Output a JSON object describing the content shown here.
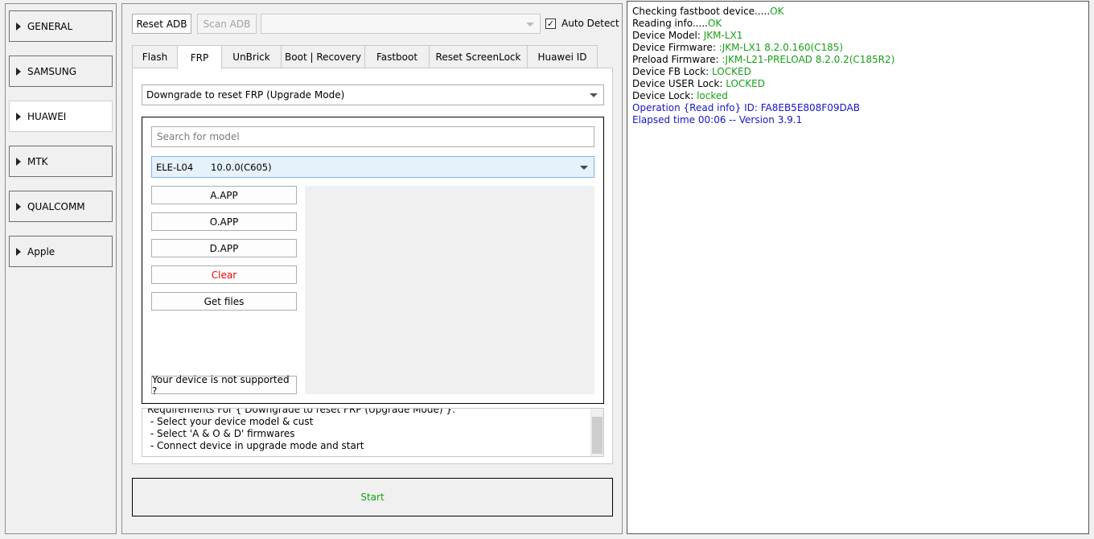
{
  "sidebar": {
    "items": [
      {
        "label": "GENERAL"
      },
      {
        "label": "SAMSUNG"
      },
      {
        "label": "HUAWEI",
        "active": true
      },
      {
        "label": "MTK"
      },
      {
        "label": "QUALCOMM"
      },
      {
        "label": "Apple"
      }
    ]
  },
  "toolbar": {
    "reset_adb": "Reset ADB",
    "scan_adb": "Scan ADB",
    "port_combo_value": "",
    "auto_detect_label": "Auto Detect",
    "auto_detect_checked": true
  },
  "tabs": [
    {
      "label": "Flash"
    },
    {
      "label": "FRP",
      "active": true
    },
    {
      "label": "UnBrick"
    },
    {
      "label": "Boot | Recovery"
    },
    {
      "label": "Fastboot"
    },
    {
      "label": "Reset ScreenLock"
    },
    {
      "label": "Huawei ID"
    }
  ],
  "frp": {
    "operation_value": "Downgrade to reset FRP (Upgrade Mode)",
    "search_placeholder": "Search for model",
    "model_value": "ELE-L04      10.0.0(C605)",
    "buttons": {
      "a_app": "A.APP",
      "o_app": "O.APP",
      "d_app": "D.APP",
      "clear": "Clear",
      "get_files": "Get files",
      "not_supported": "Your device is not supported ?"
    },
    "requirements": [
      "Requirements For { Downgrade to reset FRP (Upgrade Mode) }:",
      " - Select your device model & cust",
      " - Select 'A & O & D' firmwares",
      " - Connect device in upgrade mode and start"
    ],
    "start_label": "Start"
  },
  "log": {
    "l1_label": "Checking fastboot device.....",
    "l1_value": "OK",
    "l2_label": "Reading info.....",
    "l2_value": "OK",
    "l3_label": "Device Model: ",
    "l3_value": "JKM-LX1",
    "l4_label": "Device Firmware: ",
    "l4_value": ":JKM-LX1 8.2.0.160(C185)",
    "l5_label": "Preload Firmware: ",
    "l5_value": ":JKM-L21-PRELOAD 8.2.0.2(C185R2)",
    "l6_label": "Device FB Lock: ",
    "l6_value": "LOCKED",
    "l7_label": "Device USER Lock: ",
    "l7_value": "LOCKED",
    "l8_label": "Device Lock: ",
    "l8_value": "locked",
    "l9": "Operation {Read info} ID: FA8EB5E808F09DAB",
    "l10": "Elapsed time 00:06 -- Version 3.9.1"
  },
  "colors": {
    "success": "#17a017",
    "info": "#1515c8",
    "danger": "#e00000"
  }
}
